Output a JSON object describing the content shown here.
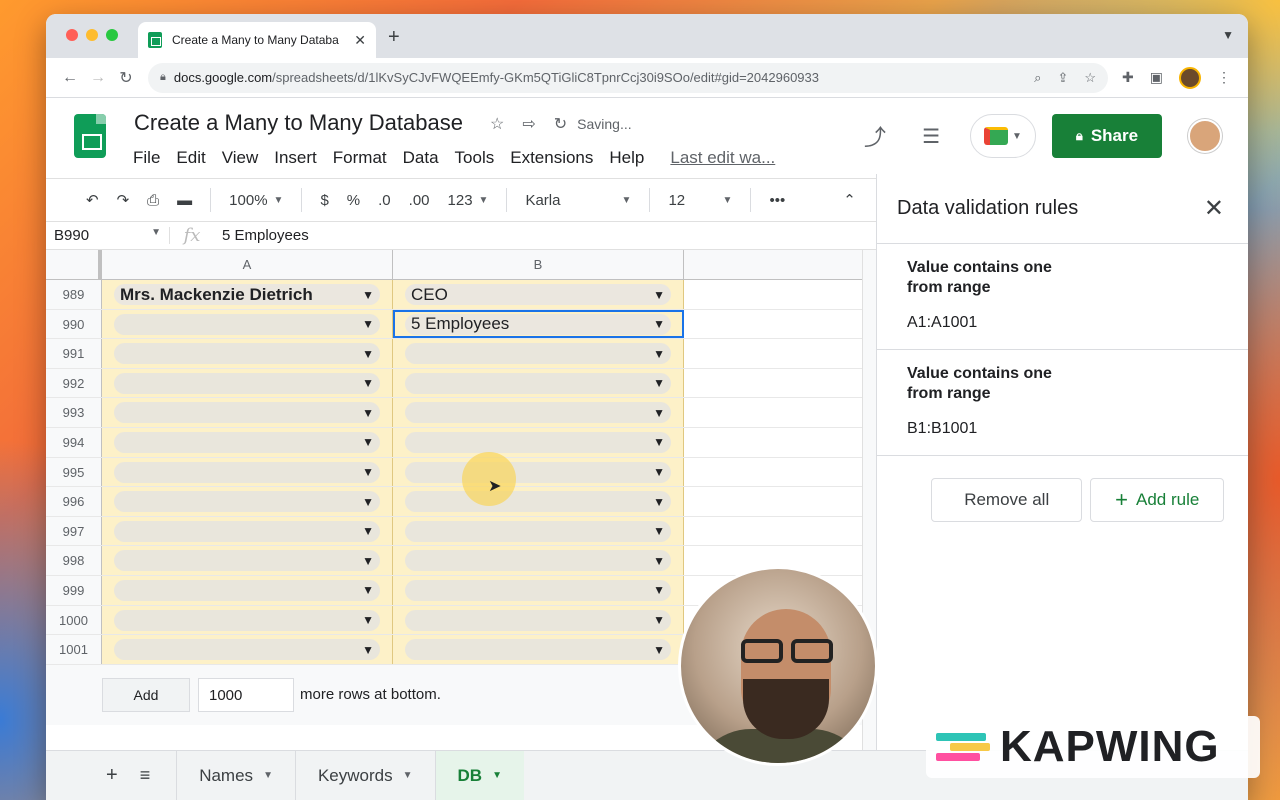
{
  "browser": {
    "tab_title": "Create a Many to Many Databa",
    "url_host": "docs.google.com",
    "url_path": "/spreadsheets/d/1lKvSyCJvFWQEEmfy-GKm5QTiGliC8TpnrCcj30i9SOo/edit#gid=2042960933"
  },
  "doc": {
    "title": "Create a Many to Many Database",
    "saving": "Saving...",
    "menu": [
      "File",
      "Edit",
      "View",
      "Insert",
      "Format",
      "Data",
      "Tools",
      "Extensions",
      "Help"
    ],
    "last_edit": "Last edit wa...",
    "share_label": "Share"
  },
  "toolbar": {
    "zoom": "100%",
    "currency": "$",
    "percent": "%",
    "dec_decrease": ".0",
    "dec_increase": ".00",
    "format_more": "123",
    "font": "Karla",
    "font_size": "12",
    "more": "•••"
  },
  "formula_bar": {
    "cell_ref": "B990",
    "fx": "fx",
    "value": "5 Employees"
  },
  "grid": {
    "col_a": "A",
    "col_b": "B",
    "rows": [
      {
        "num": "989",
        "a": "Mrs. Mackenzie Dietrich",
        "b": "CEO"
      },
      {
        "num": "990",
        "a": "",
        "b": "5 Employees"
      },
      {
        "num": "991",
        "a": "",
        "b": ""
      },
      {
        "num": "992",
        "a": "",
        "b": ""
      },
      {
        "num": "993",
        "a": "",
        "b": ""
      },
      {
        "num": "994",
        "a": "",
        "b": ""
      },
      {
        "num": "995",
        "a": "",
        "b": ""
      },
      {
        "num": "996",
        "a": "",
        "b": ""
      },
      {
        "num": "997",
        "a": "",
        "b": ""
      },
      {
        "num": "998",
        "a": "",
        "b": ""
      },
      {
        "num": "999",
        "a": "",
        "b": ""
      },
      {
        "num": "1000",
        "a": "",
        "b": ""
      },
      {
        "num": "1001",
        "a": "",
        "b": ""
      }
    ],
    "add_label": "Add",
    "add_count": "1000",
    "add_suffix": "more rows at bottom."
  },
  "sheet_tabs": {
    "tabs": [
      {
        "label": "Names",
        "active": false
      },
      {
        "label": "Keywords",
        "active": false
      },
      {
        "label": "DB",
        "active": true
      }
    ]
  },
  "side_panel": {
    "title": "Data validation rules",
    "rules": [
      {
        "condition": "Value contains one from range",
        "range": "A1:A1001"
      },
      {
        "condition": "Value contains one from range",
        "range": "B1:B1001"
      }
    ],
    "remove_all": "Remove all",
    "add_rule": "Add rule"
  },
  "watermark": {
    "text": "KAPWING"
  },
  "colors": {
    "share_green": "#188038",
    "validation_fill": "#fdf1c8",
    "selection_blue": "#1a73e8"
  }
}
